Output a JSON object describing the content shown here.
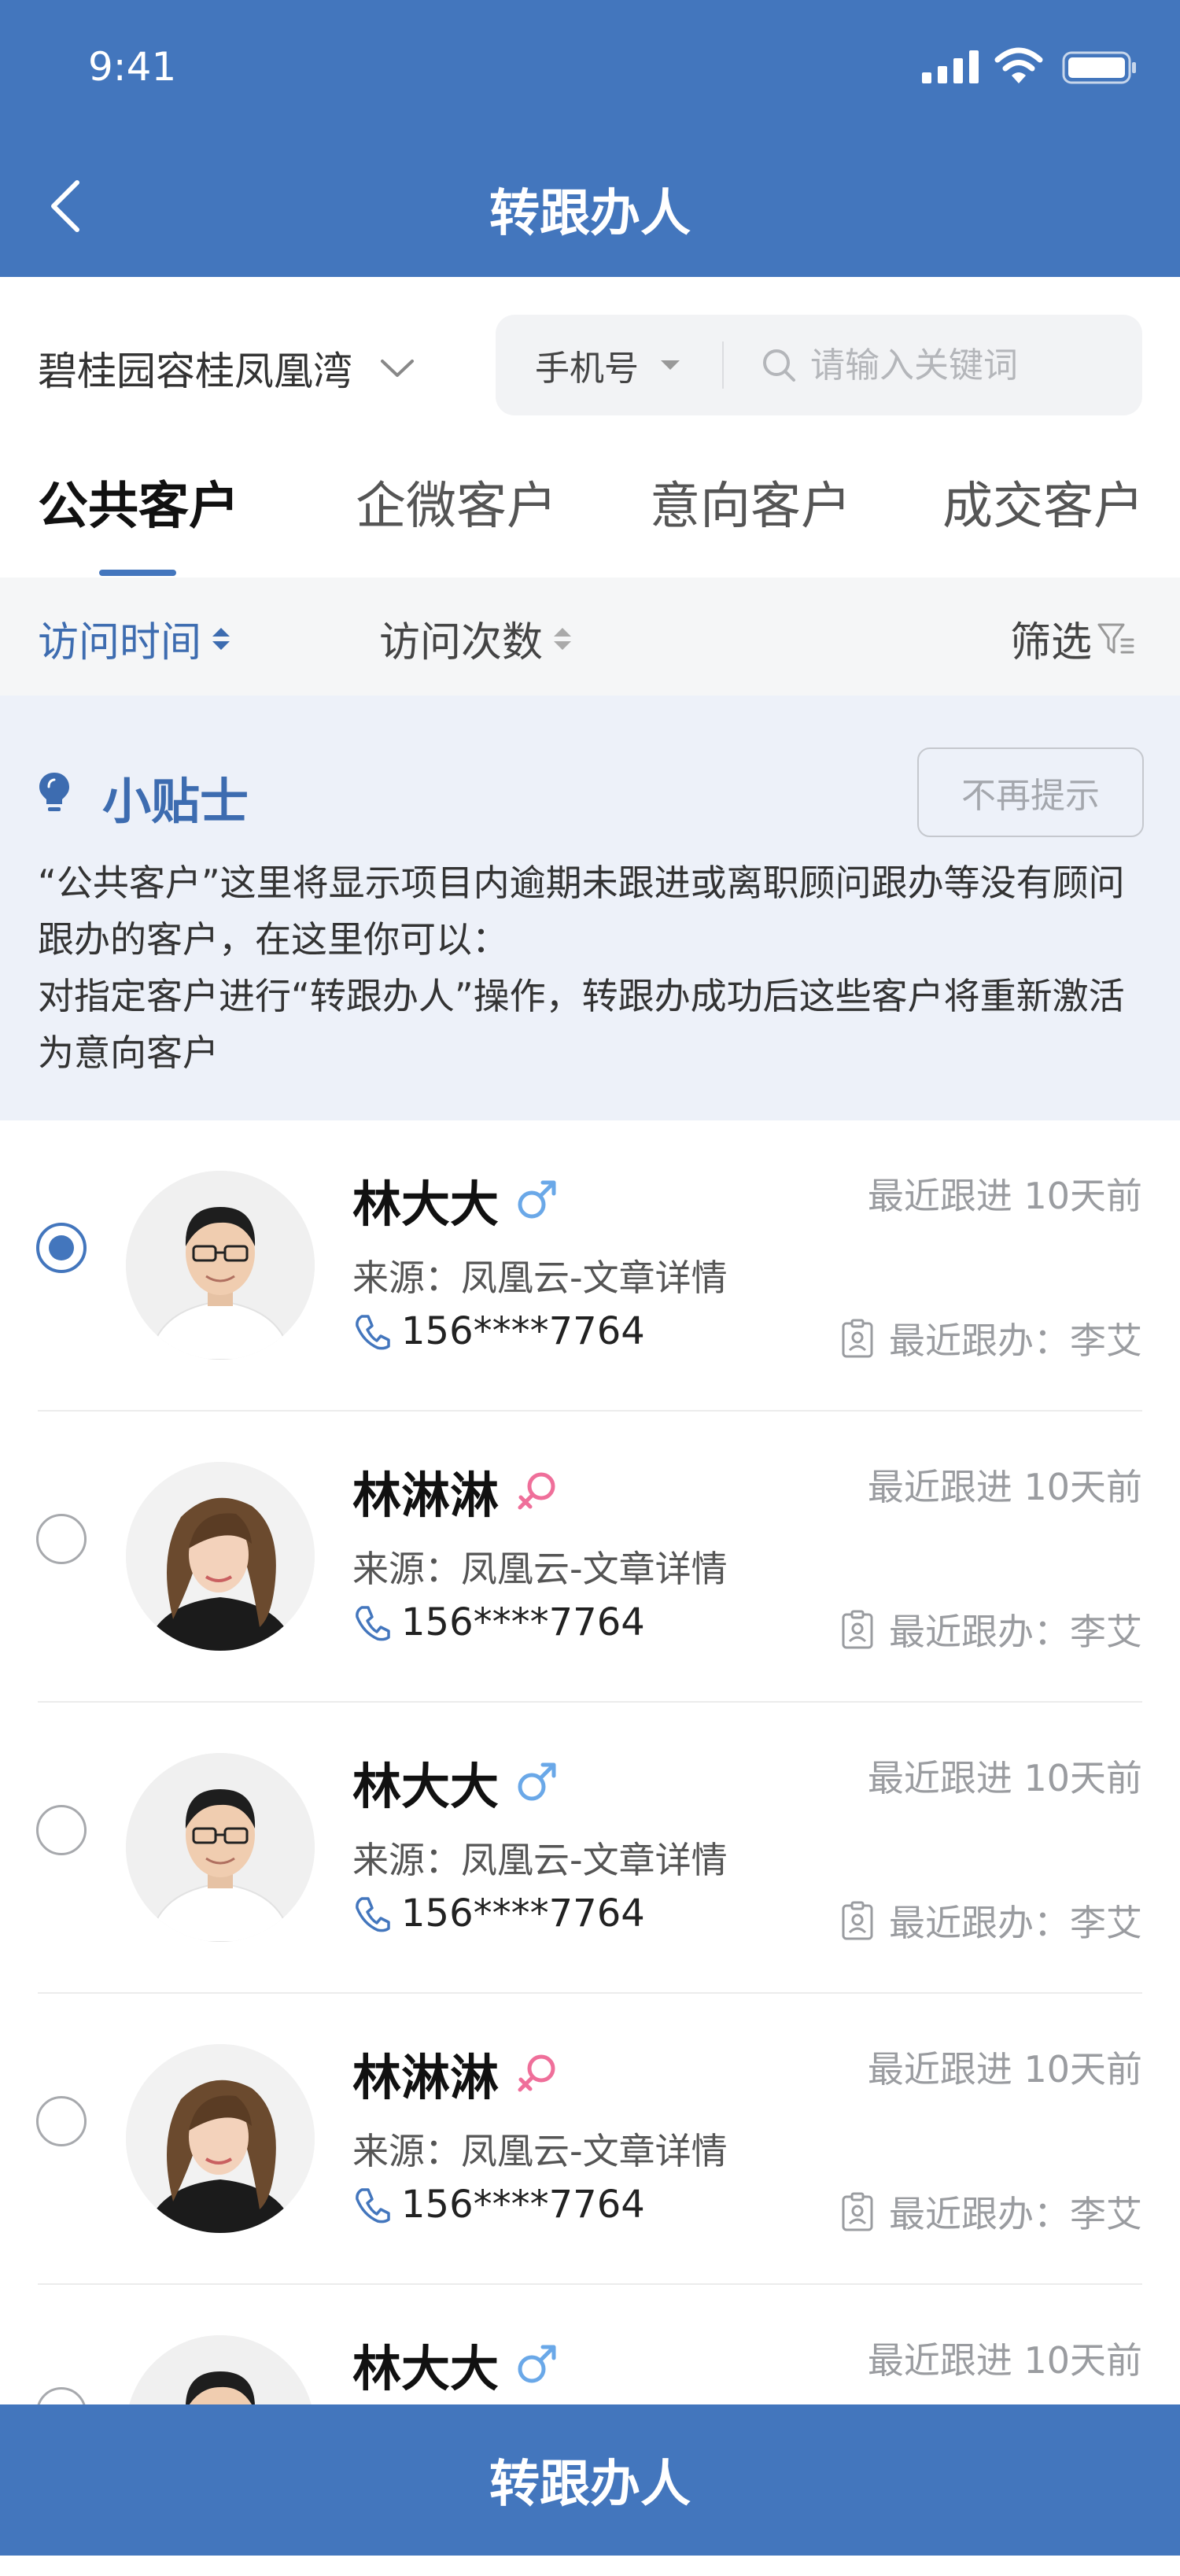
{
  "status_bar": {
    "time": "9:41"
  },
  "header": {
    "title": "转跟办人"
  },
  "project": {
    "name": "碧桂园容桂凤凰湾"
  },
  "search": {
    "type_label": "手机号",
    "placeholder": "请输入关键词"
  },
  "tabs": [
    {
      "label": "公共客户",
      "active": true
    },
    {
      "label": "企微客户",
      "active": false
    },
    {
      "label": "意向客户",
      "active": false
    },
    {
      "label": "成交客户",
      "active": false
    }
  ],
  "sort": {
    "visit_time": "访问时间",
    "visit_count": "访问次数",
    "filter": "筛选"
  },
  "tips": {
    "title": "小贴士",
    "dismiss": "不再提示",
    "line1": "“公共客户”这里将显示项目内逾期未跟进或离职顾问跟办等没有顾问跟办的客户，在这里你可以：",
    "line2": "对指定客户进行“转跟办人”操作，转跟办成功后这些客户将重新激活为意向客户"
  },
  "customers": [
    {
      "name": "林大大",
      "gender": "male",
      "source": "来源：凤凰云-文章详情",
      "phone": "156****7764",
      "recent": "最近跟进 10天前",
      "handler": "最近跟办：李艾",
      "selected": true
    },
    {
      "name": "林淋淋",
      "gender": "female",
      "source": "来源：凤凰云-文章详情",
      "phone": "156****7764",
      "recent": "最近跟进 10天前",
      "handler": "最近跟办：李艾",
      "selected": false
    },
    {
      "name": "林大大",
      "gender": "male",
      "source": "来源：凤凰云-文章详情",
      "phone": "156****7764",
      "recent": "最近跟进 10天前",
      "handler": "最近跟办：李艾",
      "selected": false
    },
    {
      "name": "林淋淋",
      "gender": "female",
      "source": "来源：凤凰云-文章详情",
      "phone": "156****7764",
      "recent": "最近跟进 10天前",
      "handler": "最近跟办：李艾",
      "selected": false
    },
    {
      "name": "林大大",
      "gender": "male",
      "recent": "最近跟进 10天前",
      "selected": false
    }
  ],
  "bottom_button": {
    "label": "转跟办人"
  },
  "colors": {
    "primary": "#4376bd",
    "male": "#6aa8e8",
    "female": "#ef6f9a",
    "tips_bg": "#edf1f9"
  }
}
